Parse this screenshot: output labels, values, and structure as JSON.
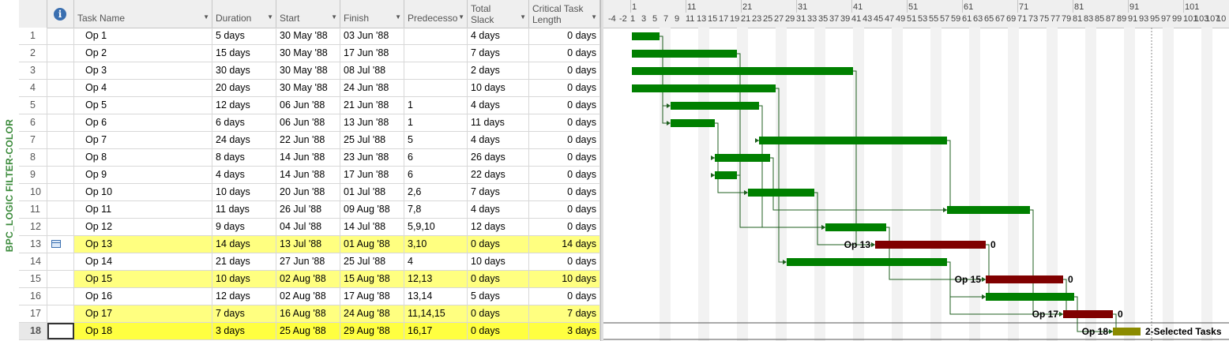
{
  "view": {
    "vertical_label": "BPC_LOGIC FILTER-COLOR"
  },
  "columns": {
    "task_name": "Task Name",
    "duration": "Duration",
    "start": "Start",
    "finish": "Finish",
    "predecessors": "Predecesso",
    "total_slack_1": "Total",
    "total_slack_2": "Slack",
    "critical_1": "Critical Task",
    "critical_2": "Length"
  },
  "timescale": {
    "upper": [
      "1",
      "11",
      "21",
      "31",
      "41",
      "51",
      "61",
      "71",
      "81",
      "91",
      "101"
    ],
    "lower": [
      "-4",
      "-2",
      "1",
      "3",
      "5",
      "7",
      "9",
      "11",
      "13",
      "15",
      "17",
      "19",
      "21",
      "23",
      "25",
      "27",
      "29",
      "31",
      "33",
      "35",
      "37",
      "39",
      "41",
      "43",
      "45",
      "47",
      "49",
      "51",
      "53",
      "55",
      "57",
      "59",
      "61",
      "63",
      "65",
      "67",
      "69",
      "71",
      "73",
      "75",
      "77",
      "79",
      "81",
      "83",
      "85",
      "87",
      "89",
      "91",
      "93",
      "95",
      "97",
      "99",
      "101",
      "103",
      "107",
      "10"
    ]
  },
  "tasks": [
    {
      "num": "1",
      "name": "Op 1",
      "duration": "5 days",
      "start": "30 May '88",
      "finish": "03 Jun '88",
      "pred": "",
      "slack": "4 days",
      "crit": "0 days",
      "hl": "none",
      "bar": {
        "s": 1,
        "d": 5,
        "type": "normal"
      }
    },
    {
      "num": "2",
      "name": "Op 2",
      "duration": "15 days",
      "start": "30 May '88",
      "finish": "17 Jun '88",
      "pred": "",
      "slack": "7 days",
      "crit": "0 days",
      "hl": "none",
      "bar": {
        "s": 1,
        "d": 19,
        "type": "normal"
      }
    },
    {
      "num": "3",
      "name": "Op 3",
      "duration": "30 days",
      "start": "30 May '88",
      "finish": "08 Jul '88",
      "pred": "",
      "slack": "2 days",
      "crit": "0 days",
      "hl": "none",
      "bar": {
        "s": 1,
        "d": 40,
        "type": "normal"
      }
    },
    {
      "num": "4",
      "name": "Op 4",
      "duration": "20 days",
      "start": "30 May '88",
      "finish": "24 Jun '88",
      "pred": "",
      "slack": "10 days",
      "crit": "0 days",
      "hl": "none",
      "bar": {
        "s": 1,
        "d": 26,
        "type": "normal"
      }
    },
    {
      "num": "5",
      "name": "Op 5",
      "duration": "12 days",
      "start": "06 Jun '88",
      "finish": "21 Jun '88",
      "pred": "1",
      "slack": "4 days",
      "crit": "0 days",
      "hl": "none",
      "bar": {
        "s": 8,
        "d": 16,
        "type": "normal"
      }
    },
    {
      "num": "6",
      "name": "Op 6",
      "duration": "6 days",
      "start": "06 Jun '88",
      "finish": "13 Jun '88",
      "pred": "1",
      "slack": "11 days",
      "crit": "0 days",
      "hl": "none",
      "bar": {
        "s": 8,
        "d": 8,
        "type": "normal"
      }
    },
    {
      "num": "7",
      "name": "Op 7",
      "duration": "24 days",
      "start": "22 Jun '88",
      "finish": "25 Jul '88",
      "pred": "5",
      "slack": "4 days",
      "crit": "0 days",
      "hl": "none",
      "bar": {
        "s": 24,
        "d": 34,
        "type": "normal"
      }
    },
    {
      "num": "8",
      "name": "Op 8",
      "duration": "8 days",
      "start": "14 Jun '88",
      "finish": "23 Jun '88",
      "pred": "6",
      "slack": "26 days",
      "crit": "0 days",
      "hl": "none",
      "bar": {
        "s": 16,
        "d": 10,
        "type": "normal"
      }
    },
    {
      "num": "9",
      "name": "Op 9",
      "duration": "4 days",
      "start": "14 Jun '88",
      "finish": "17 Jun '88",
      "pred": "6",
      "slack": "22 days",
      "crit": "0 days",
      "hl": "none",
      "bar": {
        "s": 16,
        "d": 4,
        "type": "normal"
      }
    },
    {
      "num": "10",
      "name": "Op 10",
      "duration": "10 days",
      "start": "20 Jun '88",
      "finish": "01 Jul '88",
      "pred": "2,6",
      "slack": "7 days",
      "crit": "0 days",
      "hl": "none",
      "bar": {
        "s": 22,
        "d": 12,
        "type": "normal"
      }
    },
    {
      "num": "11",
      "name": "Op 11",
      "duration": "11 days",
      "start": "26 Jul '88",
      "finish": "09 Aug '88",
      "pred": "7,8",
      "slack": "4 days",
      "crit": "0 days",
      "hl": "none",
      "bar": {
        "s": 58,
        "d": 15,
        "type": "normal"
      }
    },
    {
      "num": "12",
      "name": "Op 12",
      "duration": "9 days",
      "start": "04 Jul '88",
      "finish": "14 Jul '88",
      "pred": "5,9,10",
      "slack": "12 days",
      "crit": "0 days",
      "hl": "none",
      "bar": {
        "s": 36,
        "d": 11,
        "type": "normal"
      }
    },
    {
      "num": "13",
      "name": "Op 13",
      "duration": "14 days",
      "start": "13 Jul '88",
      "finish": "01 Aug '88",
      "pred": "3,10",
      "slack": "0 days",
      "crit": "14 days",
      "hl": "yellow",
      "indicator": "calendar-icon",
      "bar": {
        "s": 45,
        "d": 20,
        "type": "critical",
        "label": "Op 13",
        "slack_label": "0"
      }
    },
    {
      "num": "14",
      "name": "Op 14",
      "duration": "21 days",
      "start": "27 Jun '88",
      "finish": "25 Jul '88",
      "pred": "4",
      "slack": "10 days",
      "crit": "0 days",
      "hl": "none",
      "bar": {
        "s": 29,
        "d": 29,
        "type": "normal"
      }
    },
    {
      "num": "15",
      "name": "Op 15",
      "duration": "10 days",
      "start": "02 Aug '88",
      "finish": "15 Aug '88",
      "pred": "12,13",
      "slack": "0 days",
      "crit": "10 days",
      "hl": "yellow",
      "bar": {
        "s": 65,
        "d": 14,
        "type": "critical",
        "label": "Op 15",
        "slack_label": "0"
      }
    },
    {
      "num": "16",
      "name": "Op 16",
      "duration": "12 days",
      "start": "02 Aug '88",
      "finish": "17 Aug '88",
      "pred": "13,14",
      "slack": "5 days",
      "crit": "0 days",
      "hl": "none",
      "bar": {
        "s": 65,
        "d": 16,
        "type": "normal"
      }
    },
    {
      "num": "17",
      "name": "Op 17",
      "duration": "7 days",
      "start": "16 Aug '88",
      "finish": "24 Aug '88",
      "pred": "11,14,15",
      "slack": "0 days",
      "crit": "7 days",
      "hl": "yellow",
      "bar": {
        "s": 79,
        "d": 9,
        "type": "critical",
        "label": "Op 17",
        "slack_label": "0"
      }
    },
    {
      "num": "18",
      "name": "Op 18",
      "duration": "3 days",
      "start": "25 Aug '88",
      "finish": "29 Aug '88",
      "pred": "16,17",
      "slack": "0 days",
      "crit": "3 days",
      "hl": "selected",
      "bar": {
        "s": 88,
        "d": 5,
        "type": "selected",
        "label": "Op 18",
        "right_label": "2-Selected Tasks"
      }
    }
  ],
  "colors": {
    "normal": "#008000",
    "critical": "#800000",
    "selected": "#8b8b00",
    "link": "#1f5f1f",
    "highlight": "#ffff80",
    "selected_row": "#ffff40"
  }
}
